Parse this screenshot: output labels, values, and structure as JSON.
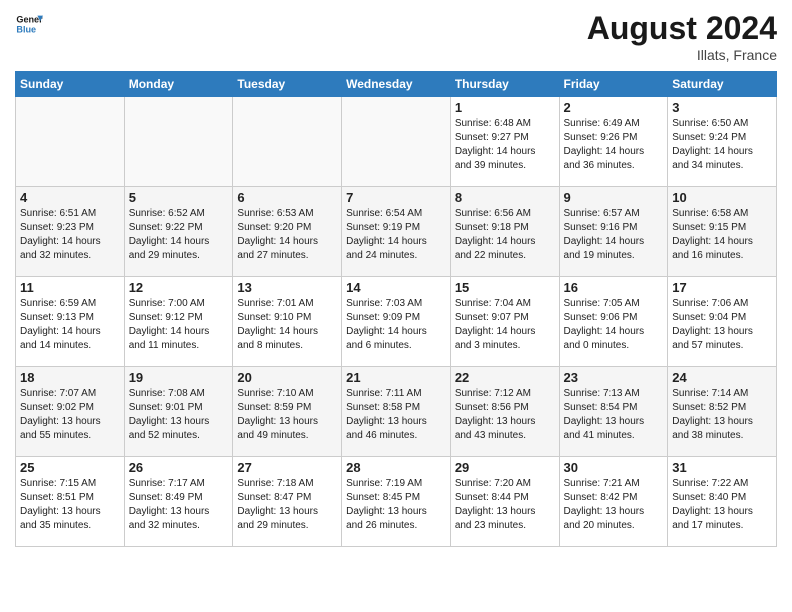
{
  "header": {
    "logo_general": "General",
    "logo_blue": "Blue",
    "month_year": "August 2024",
    "location": "Illats, France"
  },
  "days_of_week": [
    "Sunday",
    "Monday",
    "Tuesday",
    "Wednesday",
    "Thursday",
    "Friday",
    "Saturday"
  ],
  "weeks": [
    [
      {
        "day": "",
        "sunrise": "",
        "sunset": "",
        "daylight": ""
      },
      {
        "day": "",
        "sunrise": "",
        "sunset": "",
        "daylight": ""
      },
      {
        "day": "",
        "sunrise": "",
        "sunset": "",
        "daylight": ""
      },
      {
        "day": "",
        "sunrise": "",
        "sunset": "",
        "daylight": ""
      },
      {
        "day": "1",
        "sunrise": "6:48 AM",
        "sunset": "9:27 PM",
        "daylight": "14 hours and 39 minutes."
      },
      {
        "day": "2",
        "sunrise": "6:49 AM",
        "sunset": "9:26 PM",
        "daylight": "14 hours and 36 minutes."
      },
      {
        "day": "3",
        "sunrise": "6:50 AM",
        "sunset": "9:24 PM",
        "daylight": "14 hours and 34 minutes."
      }
    ],
    [
      {
        "day": "4",
        "sunrise": "6:51 AM",
        "sunset": "9:23 PM",
        "daylight": "14 hours and 32 minutes."
      },
      {
        "day": "5",
        "sunrise": "6:52 AM",
        "sunset": "9:22 PM",
        "daylight": "14 hours and 29 minutes."
      },
      {
        "day": "6",
        "sunrise": "6:53 AM",
        "sunset": "9:20 PM",
        "daylight": "14 hours and 27 minutes."
      },
      {
        "day": "7",
        "sunrise": "6:54 AM",
        "sunset": "9:19 PM",
        "daylight": "14 hours and 24 minutes."
      },
      {
        "day": "8",
        "sunrise": "6:56 AM",
        "sunset": "9:18 PM",
        "daylight": "14 hours and 22 minutes."
      },
      {
        "day": "9",
        "sunrise": "6:57 AM",
        "sunset": "9:16 PM",
        "daylight": "14 hours and 19 minutes."
      },
      {
        "day": "10",
        "sunrise": "6:58 AM",
        "sunset": "9:15 PM",
        "daylight": "14 hours and 16 minutes."
      }
    ],
    [
      {
        "day": "11",
        "sunrise": "6:59 AM",
        "sunset": "9:13 PM",
        "daylight": "14 hours and 14 minutes."
      },
      {
        "day": "12",
        "sunrise": "7:00 AM",
        "sunset": "9:12 PM",
        "daylight": "14 hours and 11 minutes."
      },
      {
        "day": "13",
        "sunrise": "7:01 AM",
        "sunset": "9:10 PM",
        "daylight": "14 hours and 8 minutes."
      },
      {
        "day": "14",
        "sunrise": "7:03 AM",
        "sunset": "9:09 PM",
        "daylight": "14 hours and 6 minutes."
      },
      {
        "day": "15",
        "sunrise": "7:04 AM",
        "sunset": "9:07 PM",
        "daylight": "14 hours and 3 minutes."
      },
      {
        "day": "16",
        "sunrise": "7:05 AM",
        "sunset": "9:06 PM",
        "daylight": "14 hours and 0 minutes."
      },
      {
        "day": "17",
        "sunrise": "7:06 AM",
        "sunset": "9:04 PM",
        "daylight": "13 hours and 57 minutes."
      }
    ],
    [
      {
        "day": "18",
        "sunrise": "7:07 AM",
        "sunset": "9:02 PM",
        "daylight": "13 hours and 55 minutes."
      },
      {
        "day": "19",
        "sunrise": "7:08 AM",
        "sunset": "9:01 PM",
        "daylight": "13 hours and 52 minutes."
      },
      {
        "day": "20",
        "sunrise": "7:10 AM",
        "sunset": "8:59 PM",
        "daylight": "13 hours and 49 minutes."
      },
      {
        "day": "21",
        "sunrise": "7:11 AM",
        "sunset": "8:58 PM",
        "daylight": "13 hours and 46 minutes."
      },
      {
        "day": "22",
        "sunrise": "7:12 AM",
        "sunset": "8:56 PM",
        "daylight": "13 hours and 43 minutes."
      },
      {
        "day": "23",
        "sunrise": "7:13 AM",
        "sunset": "8:54 PM",
        "daylight": "13 hours and 41 minutes."
      },
      {
        "day": "24",
        "sunrise": "7:14 AM",
        "sunset": "8:52 PM",
        "daylight": "13 hours and 38 minutes."
      }
    ],
    [
      {
        "day": "25",
        "sunrise": "7:15 AM",
        "sunset": "8:51 PM",
        "daylight": "13 hours and 35 minutes."
      },
      {
        "day": "26",
        "sunrise": "7:17 AM",
        "sunset": "8:49 PM",
        "daylight": "13 hours and 32 minutes."
      },
      {
        "day": "27",
        "sunrise": "7:18 AM",
        "sunset": "8:47 PM",
        "daylight": "13 hours and 29 minutes."
      },
      {
        "day": "28",
        "sunrise": "7:19 AM",
        "sunset": "8:45 PM",
        "daylight": "13 hours and 26 minutes."
      },
      {
        "day": "29",
        "sunrise": "7:20 AM",
        "sunset": "8:44 PM",
        "daylight": "13 hours and 23 minutes."
      },
      {
        "day": "30",
        "sunrise": "7:21 AM",
        "sunset": "8:42 PM",
        "daylight": "13 hours and 20 minutes."
      },
      {
        "day": "31",
        "sunrise": "7:22 AM",
        "sunset": "8:40 PM",
        "daylight": "13 hours and 17 minutes."
      }
    ]
  ]
}
